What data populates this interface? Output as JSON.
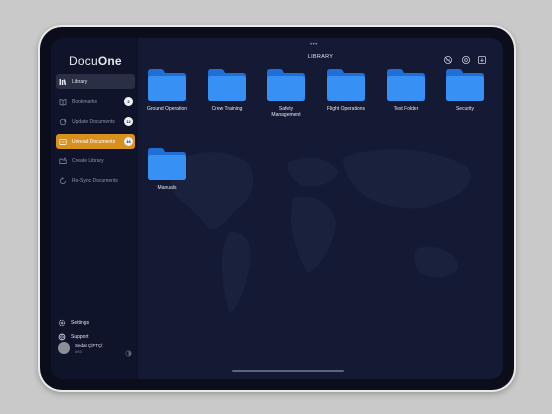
{
  "app": {
    "logo_light": "Docu",
    "logo_bold": "One"
  },
  "sidebar": {
    "items": [
      {
        "label": "Library",
        "icon": "library-icon",
        "state": "active"
      },
      {
        "label": "Bookmarks",
        "icon": "bookmark-icon",
        "badge": "2"
      },
      {
        "label": "Update Documents",
        "icon": "update-icon",
        "badge": "12"
      },
      {
        "label": "Unread Documents",
        "icon": "unread-icon",
        "badge": "16",
        "state": "highlight"
      },
      {
        "label": "Create Library",
        "icon": "create-library-icon"
      },
      {
        "label": "Re-Sync Documents",
        "icon": "resync-icon"
      }
    ],
    "settings_label": "Settings",
    "support_label": "Support",
    "user": {
      "name": "Sedat ÇİFTÇİ",
      "id": "#93"
    }
  },
  "main": {
    "title": "LIBRARY",
    "folders": [
      {
        "label": "Ground Operation"
      },
      {
        "label": "Crew Training"
      },
      {
        "label": "Safety Management"
      },
      {
        "label": "Flight Operations"
      },
      {
        "label": "Test Folder"
      },
      {
        "label": "Security"
      },
      {
        "label": "Manuals"
      }
    ]
  },
  "colors": {
    "accent": "#d8901f",
    "folder": "#2f8cf2",
    "background": "#141a33",
    "sidebar": "#10142a"
  }
}
